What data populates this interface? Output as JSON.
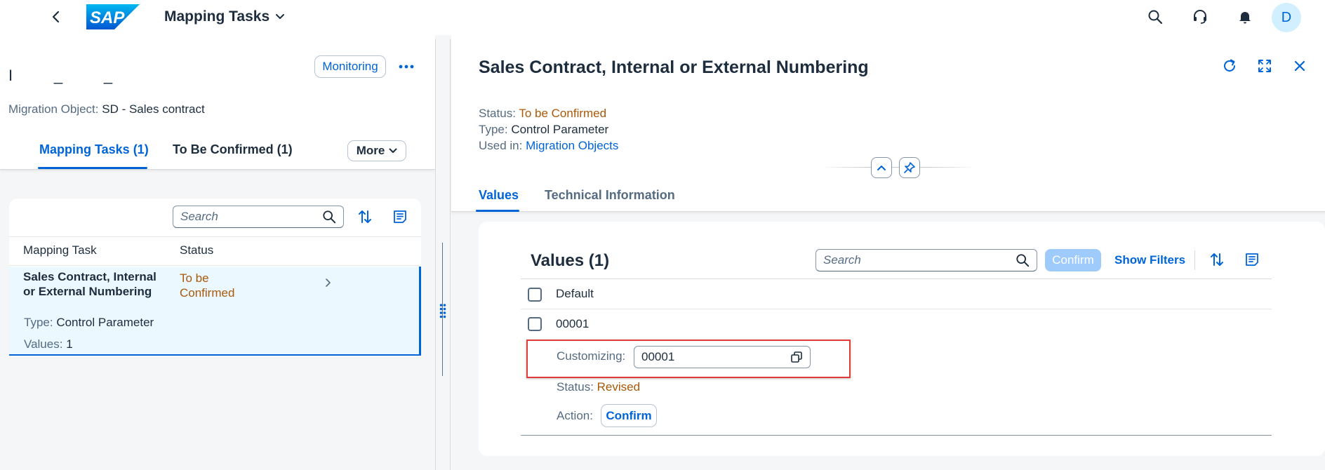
{
  "shell": {
    "app_title": "Mapping Tasks",
    "avatar_initial": "D",
    "icons": [
      "back-icon",
      "sap-logo",
      "chevron-down-icon",
      "search-icon",
      "headset-icon",
      "bell-icon"
    ]
  },
  "left": {
    "object_title": "I       _       _",
    "monitoring_label": "Monitoring",
    "migration_object_label": "Migration Object:",
    "migration_object_value": "SD - Sales contract",
    "tabs": [
      {
        "label": "Mapping Tasks (1)",
        "selected": true
      },
      {
        "label": "To Be Confirmed (1)",
        "selected": false
      }
    ],
    "more_label": "More",
    "search_placeholder": "Search",
    "columns": [
      "Mapping Task",
      "Status"
    ],
    "row": {
      "title": "Sales Contract, Internal or External Numbering",
      "status": "To be Confirmed",
      "type_label": "Type:",
      "type_value": "Control Parameter",
      "values_label": "Values:",
      "values_value": "1"
    }
  },
  "detail": {
    "title": "Sales Contract, Internal or External Numbering",
    "status_label": "Status:",
    "status_value": "To be Confirmed",
    "type_label": "Type:",
    "type_value": "Control Parameter",
    "used_label": "Used in:",
    "used_value": "Migration Objects",
    "tabs": [
      {
        "label": "Values",
        "selected": true
      },
      {
        "label": "Technical Information",
        "selected": false
      }
    ],
    "values": {
      "title": "Values (1)",
      "search_placeholder": "Search",
      "confirm_label": "Confirm",
      "show_filters_label": "Show Filters",
      "header_label": "Default",
      "row_value": "00001",
      "customizing_label": "Customizing:",
      "customizing_value": "00001",
      "status_label": "Status:",
      "status_value": "Revised",
      "action_label": "Action:",
      "action_button_label": "Confirm"
    }
  },
  "colors": {
    "accent": "#0064d9",
    "warning_text": "#aa5808",
    "highlight_box": "#e03a3a",
    "selected_row": "#ebf8ff"
  }
}
